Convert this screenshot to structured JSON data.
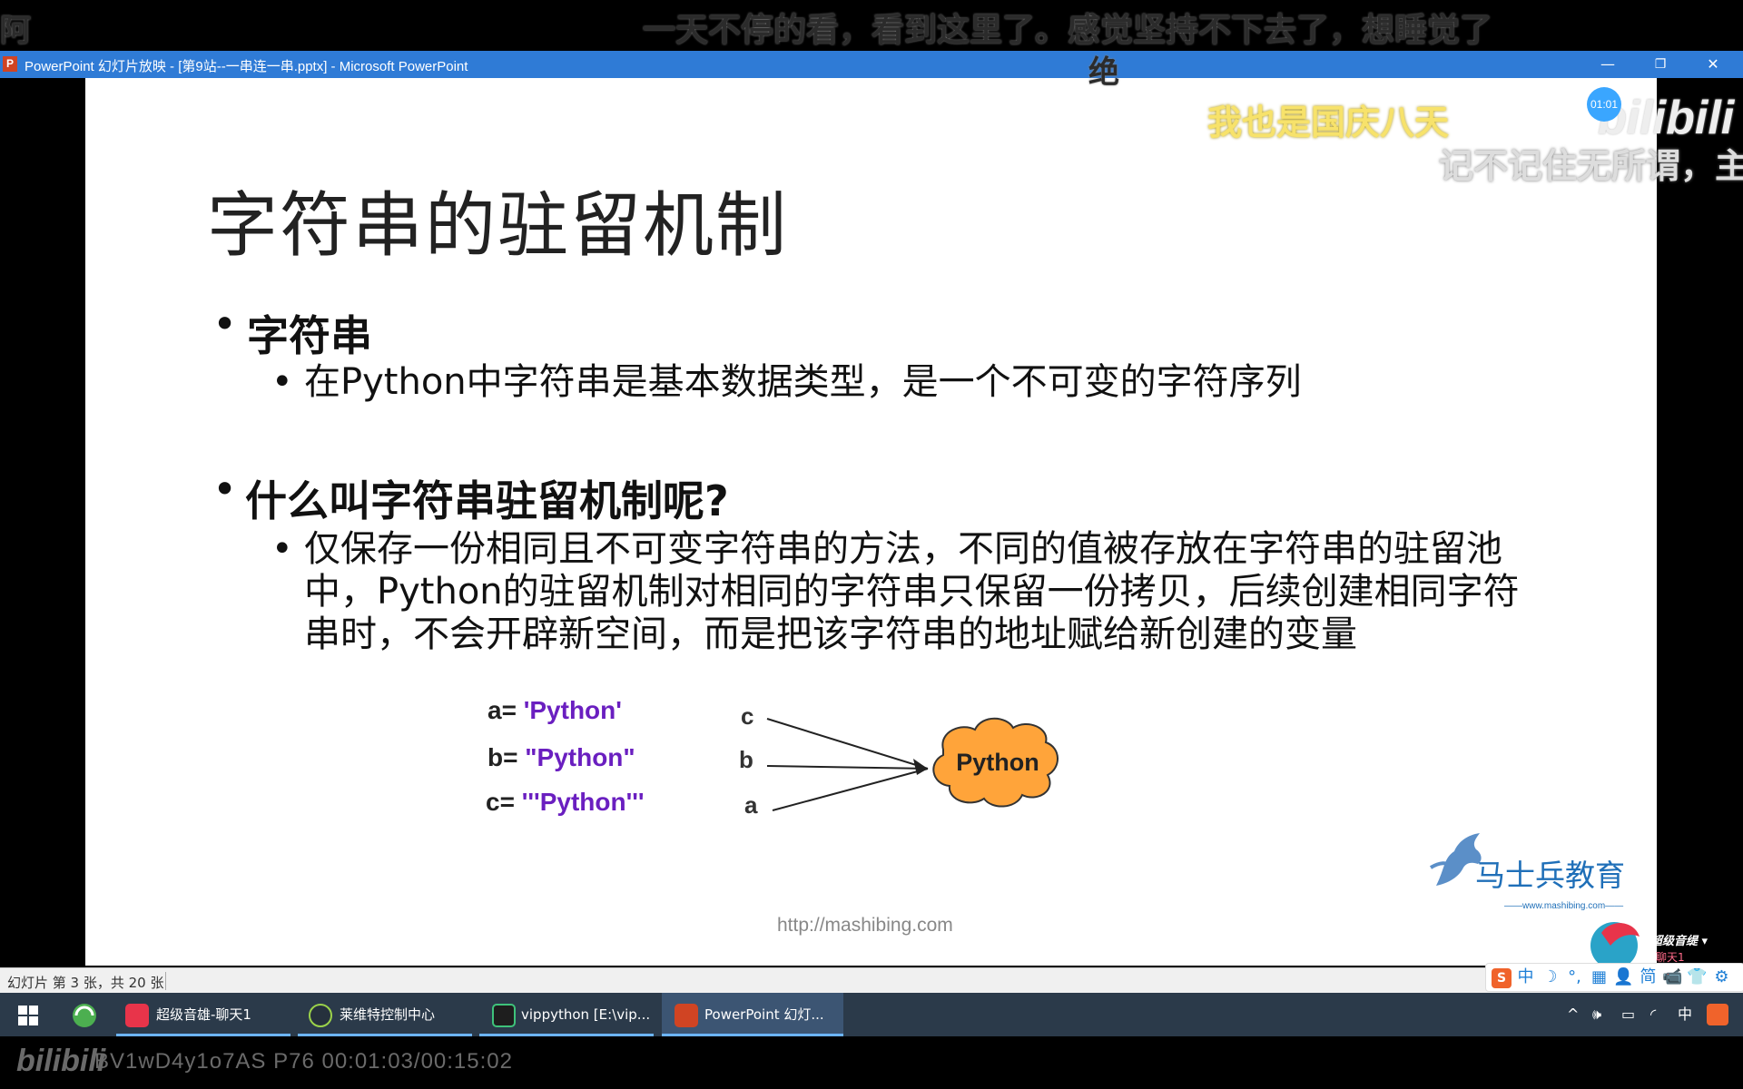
{
  "danmaku": {
    "left_fragment": "阿",
    "line1": "一天不停的看，看到这里了。感觉坚持不下去了，想睡觉了",
    "line1_wrap": "绝",
    "line2": "我也是国庆八天",
    "line3": "记不记住无所谓，主"
  },
  "player": {
    "timer_badge": "01:01",
    "watermark": "bilibili",
    "bottom_logo": "bilibili",
    "video_info": "BV1wD4y1o7AS P76 00:01:03/00:15:02"
  },
  "window": {
    "icon_letter": "P",
    "title": "PowerPoint 幻灯片放映 - [第9站--一串连一串.pptx] - Microsoft PowerPoint",
    "minimize": "—",
    "restore": "❐",
    "close": "✕",
    "titlebar_color": "#2f7bd6"
  },
  "slide": {
    "title": "字符串的驻留机制",
    "bullet_char": "•",
    "bullet1": "字符串",
    "bullet1_sub": "在Python中字符串是基本数据类型，是一个不可变的字符序列",
    "bullet2": "什么叫字符串驻留机制呢?",
    "bullet2_sub": "仅保存一份相同且不可变字符串的方法，不同的值被存放在字符串的驻留池中，Python的驻留机制对相同的字符串只保留一份拷贝，后续创建相同字符串时，不会开辟新空间，而是把该字符串的地址赋给新创建的变量",
    "code": {
      "a_var": "a=",
      "a_val": "'Python'",
      "b_var": "b=",
      "b_val": "\"Python\"",
      "c_var": "c=",
      "c_val": "'''Python'''"
    },
    "diagram": {
      "vars": [
        "c",
        "b",
        "a"
      ],
      "cloud_label": "Python",
      "cloud_color": "#ffa43a"
    },
    "url": "http://mashibing.com",
    "logo_text": "马士兵教育",
    "logo_url": "——www.mashibing.com——",
    "accent_string_color": "#6a1fc0"
  },
  "statusbar": {
    "text": "幻灯片 第 3 张，共 20 张"
  },
  "ime": {
    "logo": "S",
    "items": [
      "中",
      "☽",
      "°,",
      "▦",
      "👤",
      "简",
      "📹",
      "👕",
      "⚙"
    ]
  },
  "live_widget": {
    "label": "超级音缇 ▾",
    "sub": "聊天1"
  },
  "taskbar": {
    "items": [
      {
        "label": "超级音雄-聊天1"
      },
      {
        "label": "莱维特控制中心"
      },
      {
        "label": "vippython [E:\\vip..."
      },
      {
        "label": "PowerPoint 幻灯..."
      }
    ],
    "tray": {
      "chevron": "^",
      "volume": "🕪",
      "battery": "▭",
      "network": "◜",
      "ime": "中"
    }
  }
}
